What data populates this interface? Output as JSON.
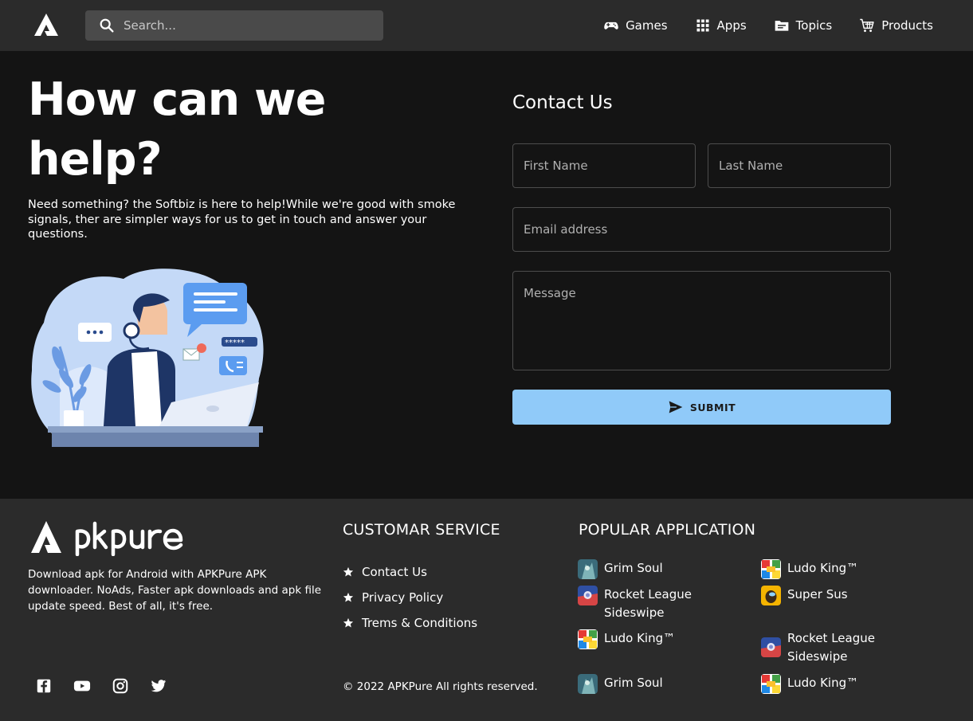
{
  "header": {
    "search_placeholder": "Search...",
    "nav": [
      {
        "label": "Games",
        "icon": "gamepad-icon"
      },
      {
        "label": "Apps",
        "icon": "grid-icon"
      },
      {
        "label": "Topics",
        "icon": "folder-icon"
      },
      {
        "label": "Products",
        "icon": "cart-icon"
      }
    ]
  },
  "hero": {
    "title": "How can we help?",
    "description": "Need something? the Softbiz is here to help!While we're good with smoke signals, ther are simpler ways for us to get in touch and answer your questions."
  },
  "contact": {
    "title": "Contact Us",
    "first_name_placeholder": "First Name",
    "last_name_placeholder": "Last Name",
    "email_placeholder": "Email address",
    "message_placeholder": "Message",
    "submit_label": "SUBMIT"
  },
  "footer": {
    "description": "Download apk for Android with APKPure APK downloader. NoAds, Faster apk downloads and apk file update speed. Best of all, it's free.",
    "customer_service_title": "CUSTOMAR SERVICE",
    "links": [
      "Contact Us",
      "Privacy Policy",
      "Trems & Conditions"
    ],
    "popular_title": "POPULAR APPLICATION",
    "apps": [
      {
        "name": "Grim Soul",
        "icon": "grim-soul-icon"
      },
      {
        "name": "Ludo King™",
        "icon": "ludo-king-icon"
      },
      {
        "name": "Rocket League Sideswipe",
        "icon": "rocket-league-icon"
      },
      {
        "name": "Super Sus",
        "icon": "super-sus-icon"
      },
      {
        "name": "Ludo King™",
        "icon": "ludo-king-icon"
      },
      {
        "name": "Rocket League Sideswipe",
        "icon": "rocket-league-icon"
      },
      {
        "name": "Grim Soul",
        "icon": "grim-soul-icon"
      },
      {
        "name": "Ludo King™",
        "icon": "ludo-king-icon"
      }
    ],
    "copyright": "© 2022 APKPure All rights reserved.",
    "socials": [
      "facebook-icon",
      "youtube-icon",
      "instagram-icon",
      "twitter-icon"
    ]
  },
  "colors": {
    "background": "#141414",
    "header_bg": "#2b2b2b",
    "accent": "#90caf9",
    "search_bg": "#4a4a4a"
  }
}
